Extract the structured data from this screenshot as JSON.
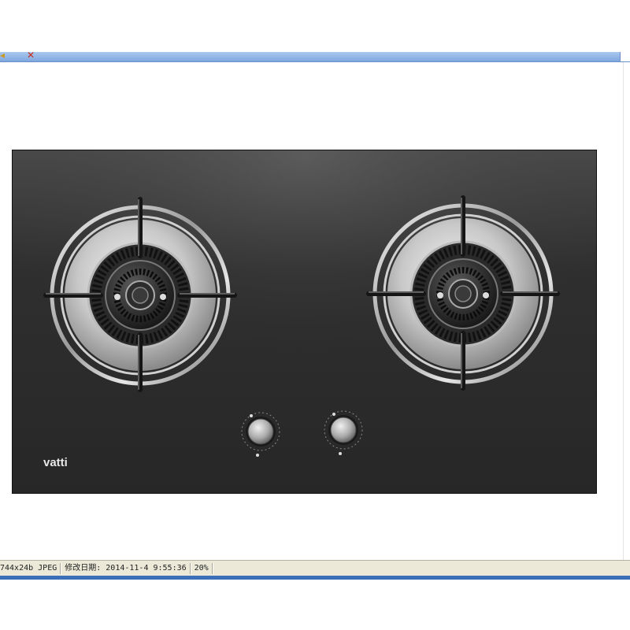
{
  "toolbar": {
    "back_icon": "back-arrow-icon",
    "close_icon": "close-x-icon"
  },
  "image": {
    "brand": "vatti",
    "burners": 2,
    "knobs": 2,
    "glass_color": "#2b2b2b"
  },
  "status_bar": {
    "format": "744x24b JPEG",
    "modified": "修改日期: 2014-11-4 9:55:36",
    "zoom": "20%"
  },
  "colors": {
    "accent_blue": "#3b6fb8",
    "status_bg": "#ece9d8"
  }
}
